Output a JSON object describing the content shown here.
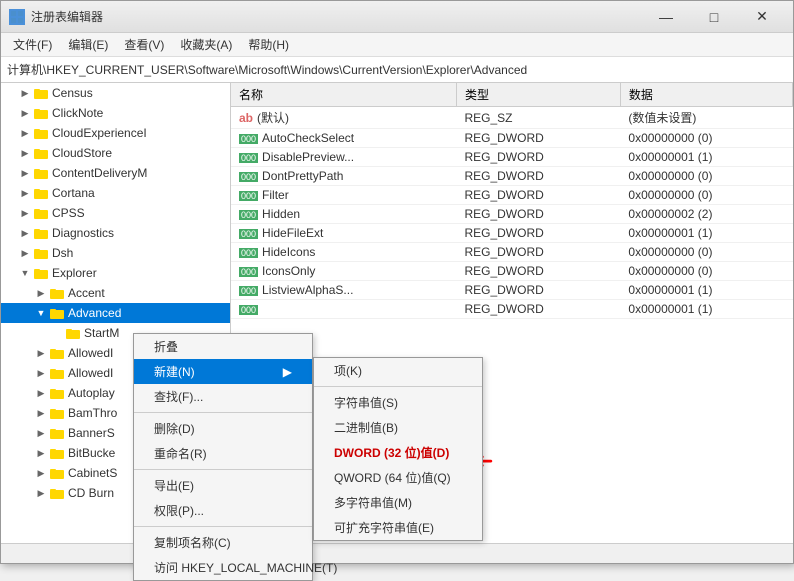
{
  "window": {
    "title": "注册表编辑器",
    "icon": "🗂"
  },
  "titlebar": {
    "minimize_label": "—",
    "maximize_label": "□",
    "close_label": "✕"
  },
  "menubar": {
    "items": [
      "文件(F)",
      "编辑(E)",
      "查看(V)",
      "收藏夹(A)",
      "帮助(H)"
    ]
  },
  "address_bar": {
    "label": "计算机\\HKEY_CURRENT_USER\\Software\\Microsoft\\Windows\\CurrentVersion\\Explorer\\Advanced"
  },
  "tree": {
    "items": [
      {
        "label": "Census",
        "indent": 1,
        "expanded": false,
        "selected": false
      },
      {
        "label": "ClickNote",
        "indent": 1,
        "expanded": false,
        "selected": false
      },
      {
        "label": "CloudExperienceI",
        "indent": 1,
        "expanded": false,
        "selected": false
      },
      {
        "label": "CloudStore",
        "indent": 1,
        "expanded": false,
        "selected": false
      },
      {
        "label": "ContentDeliveryM",
        "indent": 1,
        "expanded": false,
        "selected": false
      },
      {
        "label": "Cortana",
        "indent": 1,
        "expanded": false,
        "selected": false
      },
      {
        "label": "CPSS",
        "indent": 1,
        "expanded": false,
        "selected": false
      },
      {
        "label": "Diagnostics",
        "indent": 1,
        "expanded": false,
        "selected": false
      },
      {
        "label": "Dsh",
        "indent": 1,
        "expanded": false,
        "selected": false
      },
      {
        "label": "Explorer",
        "indent": 1,
        "expanded": true,
        "selected": false
      },
      {
        "label": "Accent",
        "indent": 2,
        "expanded": false,
        "selected": false
      },
      {
        "label": "Advanced",
        "indent": 2,
        "expanded": true,
        "selected": true
      },
      {
        "label": "StartM",
        "indent": 3,
        "expanded": false,
        "selected": false
      },
      {
        "label": "AllowedI",
        "indent": 2,
        "expanded": false,
        "selected": false
      },
      {
        "label": "AllowedI",
        "indent": 2,
        "expanded": false,
        "selected": false
      },
      {
        "label": "Autoplay",
        "indent": 2,
        "expanded": false,
        "selected": false
      },
      {
        "label": "BamThro",
        "indent": 2,
        "expanded": false,
        "selected": false
      },
      {
        "label": "BannerS",
        "indent": 2,
        "expanded": false,
        "selected": false
      },
      {
        "label": "BitBucke",
        "indent": 2,
        "expanded": false,
        "selected": false
      },
      {
        "label": "CabinetS",
        "indent": 2,
        "expanded": false,
        "selected": false
      },
      {
        "label": "CD Burn",
        "indent": 2,
        "expanded": false,
        "selected": false
      }
    ]
  },
  "data_pane": {
    "columns": [
      "名称",
      "类型",
      "数据"
    ],
    "rows": [
      {
        "icon": "ab",
        "name": "(默认)",
        "type": "REG_SZ",
        "value": "(数值未设置)"
      },
      {
        "icon": "dword",
        "name": "AutoCheckSelect",
        "type": "REG_DWORD",
        "value": "0x00000000 (0)"
      },
      {
        "icon": "dword",
        "name": "DisablePreview...",
        "type": "REG_DWORD",
        "value": "0x00000001 (1)"
      },
      {
        "icon": "dword",
        "name": "DontPrettyPath",
        "type": "REG_DWORD",
        "value": "0x00000000 (0)"
      },
      {
        "icon": "dword",
        "name": "Filter",
        "type": "REG_DWORD",
        "value": "0x00000000 (0)"
      },
      {
        "icon": "dword",
        "name": "Hidden",
        "type": "REG_DWORD",
        "value": "0x00000002 (2)"
      },
      {
        "icon": "dword",
        "name": "HideFileExt",
        "type": "REG_DWORD",
        "value": "0x00000001 (1)"
      },
      {
        "icon": "dword",
        "name": "HideIcons",
        "type": "REG_DWORD",
        "value": "0x00000000 (0)"
      },
      {
        "icon": "dword",
        "name": "IconsOnly",
        "type": "REG_DWORD",
        "value": "0x00000000 (0)"
      },
      {
        "icon": "dword",
        "name": "ListviewAlphaS...",
        "type": "REG_DWORD",
        "value": "0x00000001 (1)"
      },
      {
        "icon": "dword",
        "name": "",
        "type": "REG_DWORD",
        "value": "0x00000001 (1)"
      }
    ]
  },
  "context_menu": {
    "items": [
      {
        "label": "折叠",
        "type": "normal"
      },
      {
        "label": "新建(N)",
        "type": "submenu",
        "highlighted": true
      },
      {
        "label": "查找(F)...",
        "type": "normal"
      },
      {
        "label": "",
        "type": "separator"
      },
      {
        "label": "删除(D)",
        "type": "normal"
      },
      {
        "label": "重命名(R)",
        "type": "normal"
      },
      {
        "label": "",
        "type": "separator"
      },
      {
        "label": "导出(E)",
        "type": "normal"
      },
      {
        "label": "权限(P)...",
        "type": "normal"
      },
      {
        "label": "",
        "type": "separator"
      },
      {
        "label": "复制项名称(C)",
        "type": "normal"
      },
      {
        "label": "访问 HKEY_LOCAL_MACHINE(T)",
        "type": "normal"
      }
    ]
  },
  "submenu": {
    "items": [
      {
        "label": "项(K)"
      },
      {
        "label": ""
      },
      {
        "label": "字符串值(S)"
      },
      {
        "label": "二进制值(B)"
      },
      {
        "label": "DWORD (32 位)值(D)",
        "highlight": true
      },
      {
        "label": "QWORD (64 位)值(Q)"
      },
      {
        "label": "多字符串值(M)"
      },
      {
        "label": "可扩充字符串值(E)"
      }
    ]
  }
}
